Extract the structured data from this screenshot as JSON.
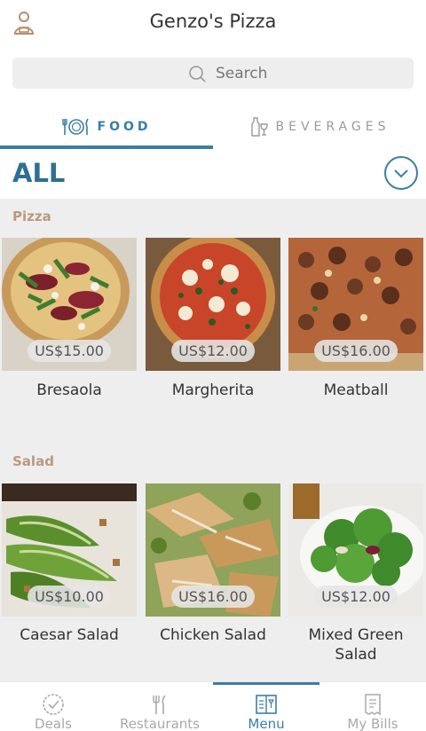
{
  "header": {
    "title": "Genzo's Pizza",
    "profile_icon": "user-profile-icon"
  },
  "search": {
    "label": "Search",
    "icon": "search-icon"
  },
  "tabs": [
    {
      "label": "FOOD",
      "icon": "cutlery-plate-icon",
      "active": true
    },
    {
      "label": "BEVERAGES",
      "icon": "bottle-glass-icon",
      "active": false
    }
  ],
  "category": {
    "title": "ALL",
    "toggle_icon": "chevron-down-circle-icon"
  },
  "sections": [
    {
      "title": "Pizza",
      "items": [
        {
          "name": "Bresaola",
          "price": "US$15.00"
        },
        {
          "name": "Margherita",
          "price": "US$12.00"
        },
        {
          "name": "Meatball",
          "price": "US$16.00"
        }
      ]
    },
    {
      "title": "Salad",
      "items": [
        {
          "name": "Caesar Salad",
          "price": "US$10.00"
        },
        {
          "name": "Chicken Salad",
          "price": "US$16.00"
        },
        {
          "name": "Mixed Green Salad",
          "price": "US$12.00"
        }
      ]
    }
  ],
  "bottom_nav": [
    {
      "label": "Deals",
      "icon": "deals-badge-icon",
      "active": false
    },
    {
      "label": "Restaurants",
      "icon": "fork-knife-icon",
      "active": false
    },
    {
      "label": "Menu",
      "icon": "menu-book-icon",
      "active": true
    },
    {
      "label": "My Bills",
      "icon": "receipt-icon",
      "active": false
    }
  ],
  "colors": {
    "accent": "#3a7ea5",
    "section_title": "#b99a80",
    "background": "#eeeeee"
  }
}
